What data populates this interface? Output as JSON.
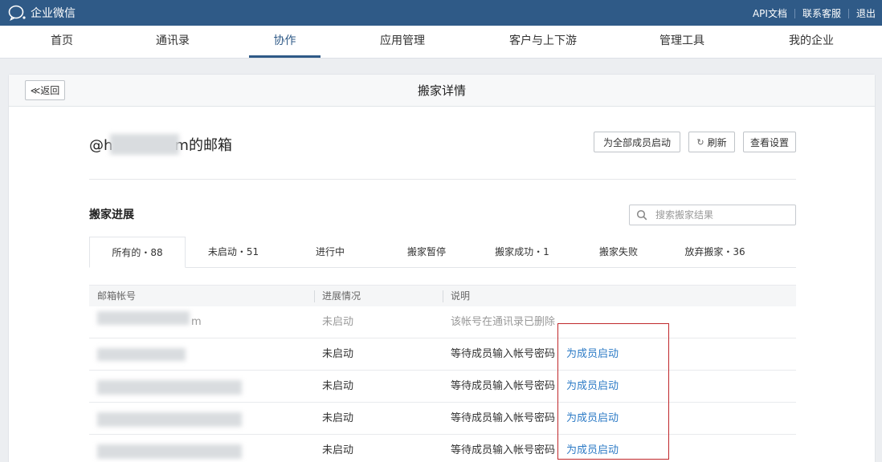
{
  "app": {
    "brand_name": "企业微信",
    "brand_icon": "wecom-chat-bubble-icon",
    "top_links": [
      "API文档",
      "联系客服",
      "退出"
    ]
  },
  "nav": {
    "items": [
      "首页",
      "通讯录",
      "协作",
      "应用管理",
      "客户与上下游",
      "管理工具",
      "我的企业"
    ],
    "active_index": 2
  },
  "page": {
    "back_label": "≪返回",
    "title": "搬家详情",
    "mailbox_prefix": "@h",
    "mailbox_suffix": "m的邮箱",
    "buttons": {
      "start_all": "为全部成员启动",
      "refresh": "刷新",
      "view_settings": "查看设置"
    }
  },
  "progress": {
    "section_title": "搬家进展",
    "search_placeholder": "搜索搬家结果",
    "tabs": [
      "所有的・88",
      "未启动・51",
      "进行中",
      "搬家暂停",
      "搬家成功・1",
      "搬家失败",
      "放弃搬家・36"
    ],
    "active_tab": 0
  },
  "table": {
    "columns": [
      "邮箱帐号",
      "进展情况",
      "说明"
    ],
    "rows": [
      {
        "account_tail": "m",
        "status": "未启动",
        "note": "该帐号在通讯录已删除",
        "action": ""
      },
      {
        "account_tail": "",
        "status": "未启动",
        "note": "等待成员输入帐号密码",
        "action": "为成员启动"
      },
      {
        "account_tail": "",
        "status": "未启动",
        "note": "等待成员输入帐号密码",
        "action": "为成员启动"
      },
      {
        "account_tail": "",
        "status": "未启动",
        "note": "等待成员输入帐号密码",
        "action": "为成员启动"
      },
      {
        "account_tail": "",
        "status": "未启动",
        "note": "等待成员输入帐号密码",
        "action": "为成员启动"
      }
    ]
  },
  "colors": {
    "topbar": "#2f5a87",
    "link": "#2d7bc6",
    "highlight": "#c0282c"
  }
}
